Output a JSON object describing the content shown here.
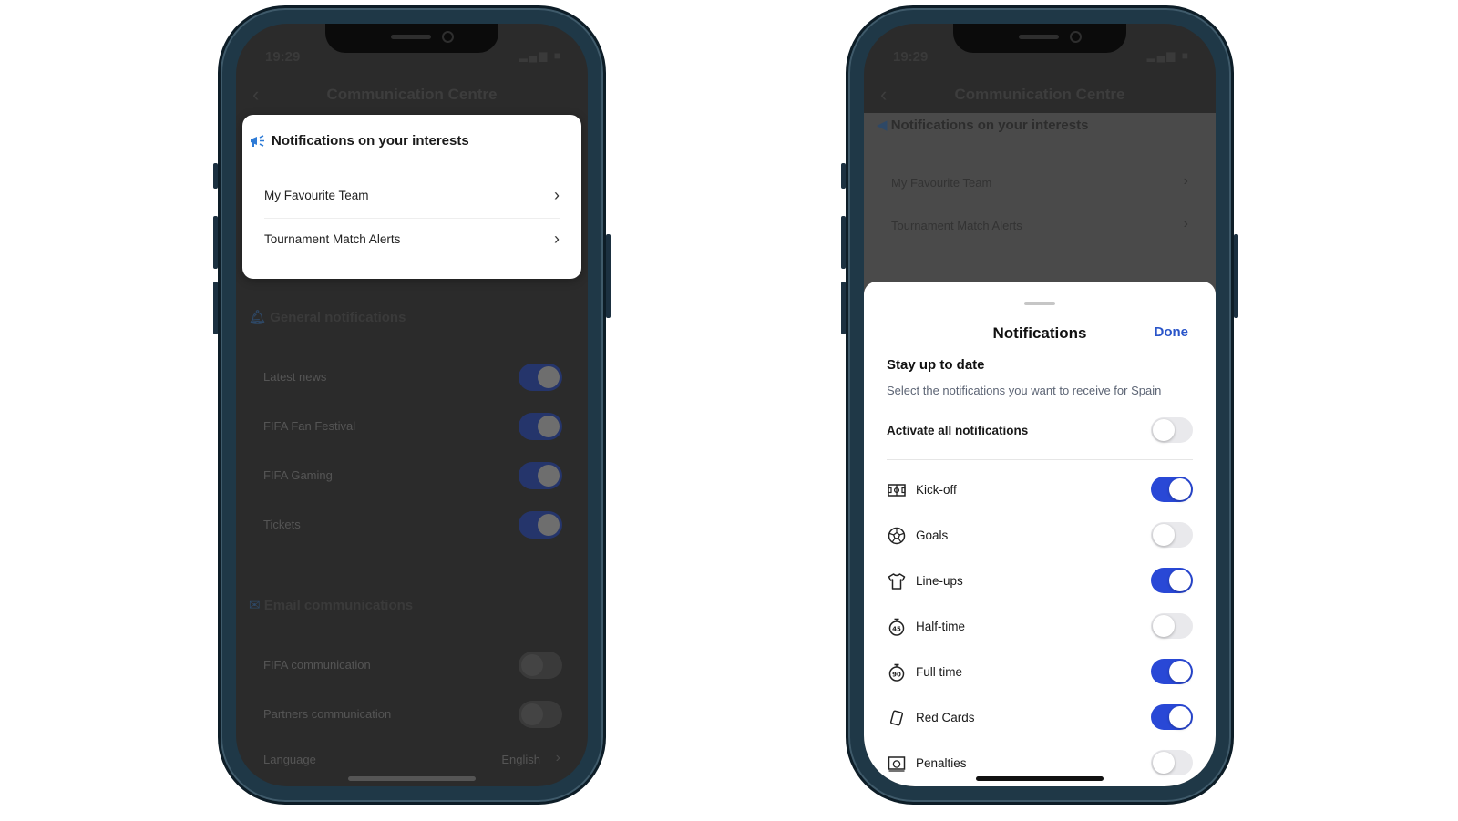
{
  "left_phone": {
    "status_time": "19:29",
    "nav_title": "Communication Centre",
    "card": {
      "title": "Notifications on your interests",
      "items": [
        {
          "label": "My Favourite Team"
        },
        {
          "label": "Tournament Match Alerts"
        }
      ]
    },
    "general": {
      "title": "General notifications",
      "items": [
        {
          "label": "Latest news",
          "on": true
        },
        {
          "label": "FIFA Fan Festival",
          "on": true
        },
        {
          "label": "FIFA Gaming",
          "on": true
        },
        {
          "label": "Tickets",
          "on": true
        }
      ]
    },
    "email": {
      "title": "Email communications",
      "items": [
        {
          "label": "FIFA communication",
          "on": false
        },
        {
          "label": "Partners communication",
          "on": false
        }
      ],
      "language_label": "Language",
      "language_value": "English"
    }
  },
  "right_phone": {
    "status_time": "19:29",
    "nav_title": "Communication Centre",
    "bg_section_title": "Notifications on your interests",
    "bg_items": [
      {
        "label": "My Favourite Team"
      },
      {
        "label": "Tournament Match Alerts"
      }
    ],
    "sheet": {
      "title": "Notifications",
      "done_label": "Done",
      "heading": "Stay up to date",
      "description": "Select the notifications you want to receive for Spain",
      "activate_all": {
        "label": "Activate all notifications",
        "on": false
      },
      "items": [
        {
          "label": "Kick-off",
          "icon": "pitch-icon",
          "on": true
        },
        {
          "label": "Goals",
          "icon": "ball-icon",
          "on": false
        },
        {
          "label": "Line-ups",
          "icon": "shirt-icon",
          "on": true
        },
        {
          "label": "Half-time",
          "icon": "timer-45-icon",
          "on": false
        },
        {
          "label": "Full time",
          "icon": "timer-90-icon",
          "on": true
        },
        {
          "label": "Red Cards",
          "icon": "card-icon",
          "on": true
        },
        {
          "label": "Penalties",
          "icon": "penalty-icon",
          "on": false
        }
      ]
    }
  },
  "colors": {
    "accent": "#2948d6",
    "done_link": "#2a55c9",
    "overlay": "#2b2b2b",
    "frame": "#1f3847"
  }
}
